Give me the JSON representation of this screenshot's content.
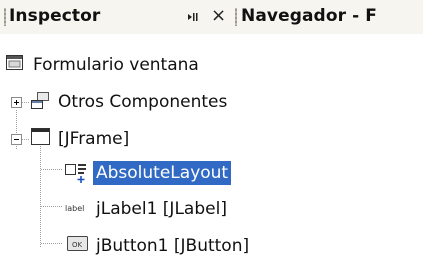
{
  "tabs": {
    "inspector": {
      "title": "Inspector",
      "pin_icon": "pin-icon",
      "close_glyph": "×"
    },
    "navigator": {
      "title": "Navegador - F"
    }
  },
  "tree": {
    "root": {
      "label": "Formulario ventana",
      "icon": "form-window-icon"
    },
    "others": {
      "label": "Otros Componentes",
      "icon": "components-icon",
      "expanded": false
    },
    "jframe": {
      "label": "[JFrame]",
      "icon": "frame-icon",
      "expanded": true
    },
    "children": [
      {
        "label": "AbsoluteLayout",
        "icon": "absolute-layout-icon",
        "selected": true
      },
      {
        "label": "jLabel1 [JLabel]",
        "icon": "label-icon",
        "icon_text": "label"
      },
      {
        "label": "jButton1 [JButton]",
        "icon": "button-icon",
        "icon_text": "OK"
      }
    ]
  },
  "colors": {
    "selection": "#316ac5",
    "tab_bg": "#f6f5f0"
  }
}
